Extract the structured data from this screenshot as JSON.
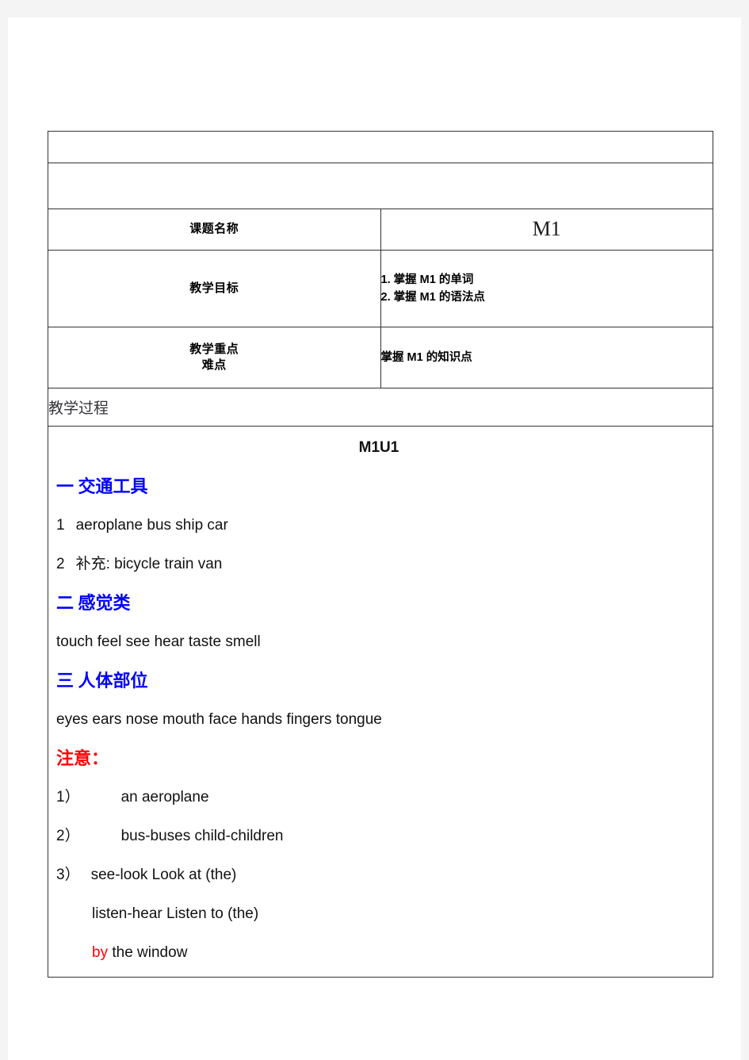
{
  "document": {
    "type": "lesson-plan-table",
    "blank_rows": 2
  },
  "table": {
    "rows": {
      "title": {
        "label": "课题名称",
        "value": "M1"
      },
      "goal": {
        "label": "教学目标",
        "items": [
          "1.  掌握 M1 的单词",
          "2.  掌握 M1 的语法点"
        ]
      },
      "focus": {
        "label_line1": "教学重点",
        "label_line2": "难点",
        "value": "掌握 M1 的知识点"
      },
      "process": {
        "label": "教学过程"
      }
    }
  },
  "content": {
    "unit_heading": "M1U1",
    "sections": [
      {
        "heading": "一  交通工具",
        "lines": [
          {
            "num": "1",
            "text": "aeroplane    bus    ship    car"
          },
          {
            "num": "2",
            "text": "补充: bicycle    train    van"
          }
        ]
      },
      {
        "heading": "二  感觉类",
        "lines": [
          {
            "text": "touch    feel    see    hear    taste    smell"
          }
        ]
      },
      {
        "heading": "三  人体部位",
        "lines": [
          {
            "text": "eyes    ears    nose     mouth    face    hands    fingers    tongue"
          }
        ]
      }
    ],
    "attention_heading": "注意：",
    "notes": [
      {
        "marker": "1）",
        "text": "an  aeroplane"
      },
      {
        "marker": "2）",
        "text": "bus-buses    child-children"
      },
      {
        "marker": "3）",
        "text": "see-look    Look  at  (the)"
      }
    ],
    "note_continuations": [
      {
        "text": "listen-hear    Listen  to  (the)"
      }
    ],
    "final_line": {
      "highlight": "by",
      "rest": " the  window"
    }
  },
  "colors": {
    "heading_blue": "#0000FF",
    "attention_red": "#FF0000",
    "border": "#333333",
    "page_background": "#F4F4F4",
    "sheet": "#FFFFFF"
  }
}
